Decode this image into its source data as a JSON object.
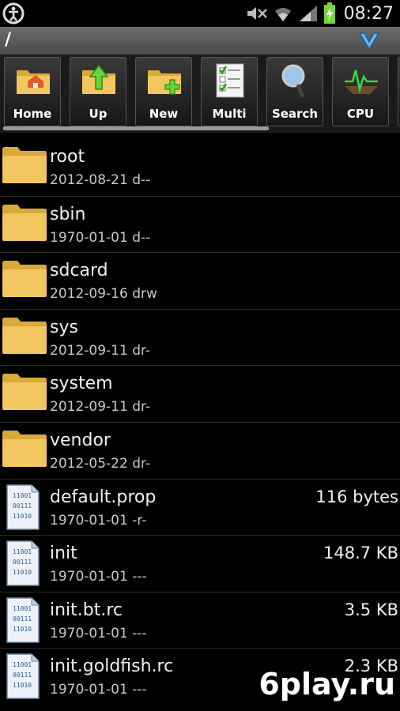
{
  "status_bar": {
    "time": "08:27",
    "left_icon": "accessibility-icon",
    "icons": [
      "mute-icon",
      "wifi-icon",
      "signal-icon",
      "battery-charging-icon"
    ]
  },
  "path_bar": {
    "path": "/",
    "menu_icon": "chevron-down-icon"
  },
  "toolbar": {
    "buttons": [
      {
        "label": "Home",
        "icon": "home-folder-icon"
      },
      {
        "label": "Up",
        "icon": "up-folder-icon"
      },
      {
        "label": "New",
        "icon": "new-folder-icon"
      },
      {
        "label": "Multi",
        "icon": "multi-select-icon"
      },
      {
        "label": "Search",
        "icon": "search-icon"
      },
      {
        "label": "CPU",
        "icon": "cpu-icon"
      }
    ]
  },
  "files": [
    {
      "name": "root",
      "meta": "2012-08-21 d--",
      "type": "folder",
      "size": ""
    },
    {
      "name": "sbin",
      "meta": "1970-01-01 d--",
      "type": "folder",
      "size": ""
    },
    {
      "name": "sdcard",
      "meta": "2012-09-16 drw",
      "type": "folder",
      "size": ""
    },
    {
      "name": "sys",
      "meta": "2012-09-11 dr-",
      "type": "folder",
      "size": ""
    },
    {
      "name": "system",
      "meta": "2012-09-11 dr-",
      "type": "folder",
      "size": ""
    },
    {
      "name": "vendor",
      "meta": "2012-05-22 dr-",
      "type": "folder",
      "size": ""
    },
    {
      "name": "default.prop",
      "meta": "1970-01-01 -r-",
      "type": "file",
      "size": "116 bytes"
    },
    {
      "name": "init",
      "meta": "1970-01-01 ---",
      "type": "file",
      "size": "148.7 KB"
    },
    {
      "name": "init.bt.rc",
      "meta": "1970-01-01 ---",
      "type": "file",
      "size": "3.5 KB"
    },
    {
      "name": "init.goldfish.rc",
      "meta": "1970-01-01 ---",
      "type": "file",
      "size": "2.3 KB"
    }
  ],
  "watermark": "6play.ru",
  "colors": {
    "folder": "#f2c760",
    "folder_dark": "#d9a93a",
    "accent_blue": "#3a8fd8"
  }
}
